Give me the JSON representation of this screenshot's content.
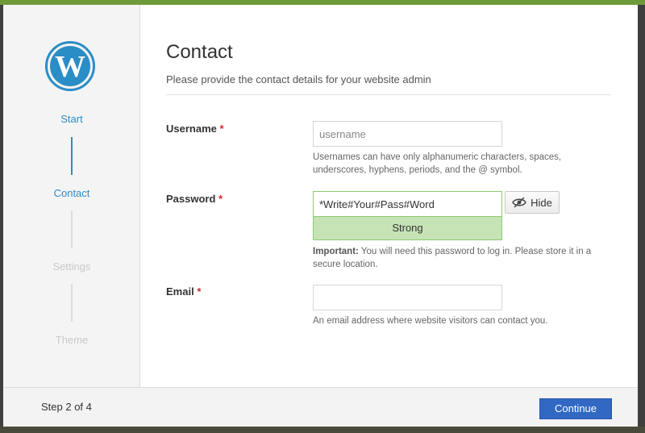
{
  "wizard": {
    "steps": [
      {
        "label": "Start",
        "state": "done"
      },
      {
        "label": "Contact",
        "state": "active"
      },
      {
        "label": "Settings",
        "state": "pending"
      },
      {
        "label": "Theme",
        "state": "pending"
      }
    ],
    "logo_icon": "wordpress-logo-icon",
    "colors": {
      "accent": "#2a8dc6",
      "inactive": "#c9c9c9",
      "primary_button": "#3068c4",
      "strength_bg": "#c6e3b5",
      "required": "#d9262c"
    }
  },
  "form": {
    "title": "Contact",
    "subtitle": "Please provide the contact details for your website admin",
    "required_marker": "*",
    "username": {
      "label": "Username",
      "placeholder": "username",
      "value": "",
      "help": "Usernames can have only alphanumeric characters, spaces, underscores, hyphens, periods, and the @ symbol."
    },
    "password": {
      "label": "Password",
      "value": "*Write#Your#Pass#Word",
      "strength": "Strong",
      "toggle_label": "Hide",
      "toggle_icon": "eye-slash-icon",
      "help_strong": "Important:",
      "help": "You will need this password to log in. Please store it in a secure location."
    },
    "email": {
      "label": "Email",
      "placeholder": "",
      "value": "",
      "help": "An email address where website visitors can contact you."
    }
  },
  "footer": {
    "step_text": "Step 2 of 4",
    "continue_label": "Continue"
  }
}
